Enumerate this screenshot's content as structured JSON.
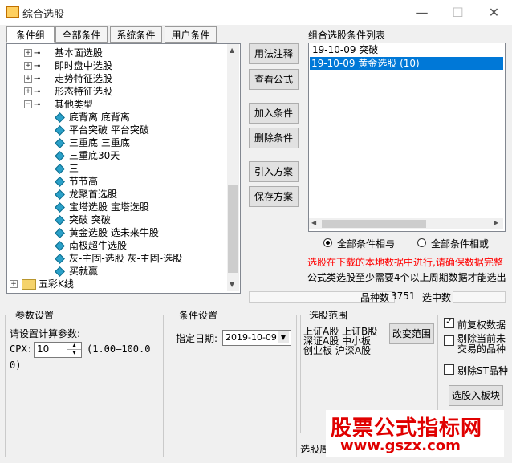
{
  "window": {
    "title": "综合选股"
  },
  "tabs": [
    {
      "label": "条件组"
    },
    {
      "label": "全部条件"
    },
    {
      "label": "系统条件"
    },
    {
      "label": "用户条件"
    }
  ],
  "tree": {
    "categories": [
      {
        "label": "基本面选股"
      },
      {
        "label": "即时盘中选股"
      },
      {
        "label": "走势特征选股"
      },
      {
        "label": "形态特征选股"
      },
      {
        "label": "其他类型"
      }
    ],
    "items": [
      {
        "label": "底背离 底背离"
      },
      {
        "label": "平台突破 平台突破"
      },
      {
        "label": "三重底 三重底"
      },
      {
        "label": "三重底30天"
      },
      {
        "label": "三"
      },
      {
        "label": "节节高"
      },
      {
        "label": "龙聚首选股"
      },
      {
        "label": "宝塔选股 宝塔选股"
      },
      {
        "label": "突破 突破"
      },
      {
        "label": "黄金选股 选未来牛股"
      },
      {
        "label": "南极超牛选股"
      },
      {
        "label": "灰-主固-选股 灰-主固-选股"
      },
      {
        "label": "买就赢"
      }
    ],
    "folder": {
      "label": "五彩K线"
    }
  },
  "buttons": {
    "usage": "用法注释",
    "view_formula": "查看公式",
    "add_condition": "加入条件",
    "delete_condition": "删除条件",
    "load_plan": "引入方案",
    "save_plan": "保存方案",
    "change_range": "改变范围",
    "to_block": "选股入板块"
  },
  "combo_list": {
    "title": "组合选股条件列表",
    "items": [
      {
        "label": "19-10-09 突破",
        "selected": false
      },
      {
        "label": "19-10-09 黄金选股 (10)",
        "selected": true
      }
    ]
  },
  "logic": {
    "and_label": "全部条件相与",
    "or_label": "全部条件相或",
    "selected": "and"
  },
  "notices": {
    "warn": "选股在下载的本地数据中进行,请确保数据完整",
    "info": "公式类选股至少需要4个以上周期数据才能选出"
  },
  "stats": {
    "total_label": "品种数",
    "total_value": "3751",
    "selected_label": "选中数"
  },
  "params": {
    "group_title": "参数设置",
    "prompt": "请设置计算参数:",
    "cpx_label": "CPX:",
    "cpx_value": "10",
    "range_line1": "(1.00—100.0",
    "range_line2": "0)"
  },
  "condition_settings": {
    "group_title": "条件设置",
    "date_label": "指定日期:",
    "date_value": "2019-10-09"
  },
  "range": {
    "group_title": "选股范围",
    "text_lines": [
      "上证A股 上证B股",
      "深证A股 中小板",
      "创业板 沪深A股"
    ],
    "period_label": "选股周"
  },
  "options": {
    "prev_adjust_label": "前复权数据",
    "prev_adjust_checked": true,
    "exclude_untraded_label": "剔除当前未交易的品种",
    "exclude_untraded_checked": false,
    "exclude_st_label": "剔除ST品种",
    "exclude_st_checked": false
  },
  "watermark": {
    "line1": "股票公式指标网",
    "line2": "www.gszx.com"
  },
  "colors": {
    "accent": "#0078d7",
    "warn": "#ff0000",
    "watermark": "#e00000"
  }
}
